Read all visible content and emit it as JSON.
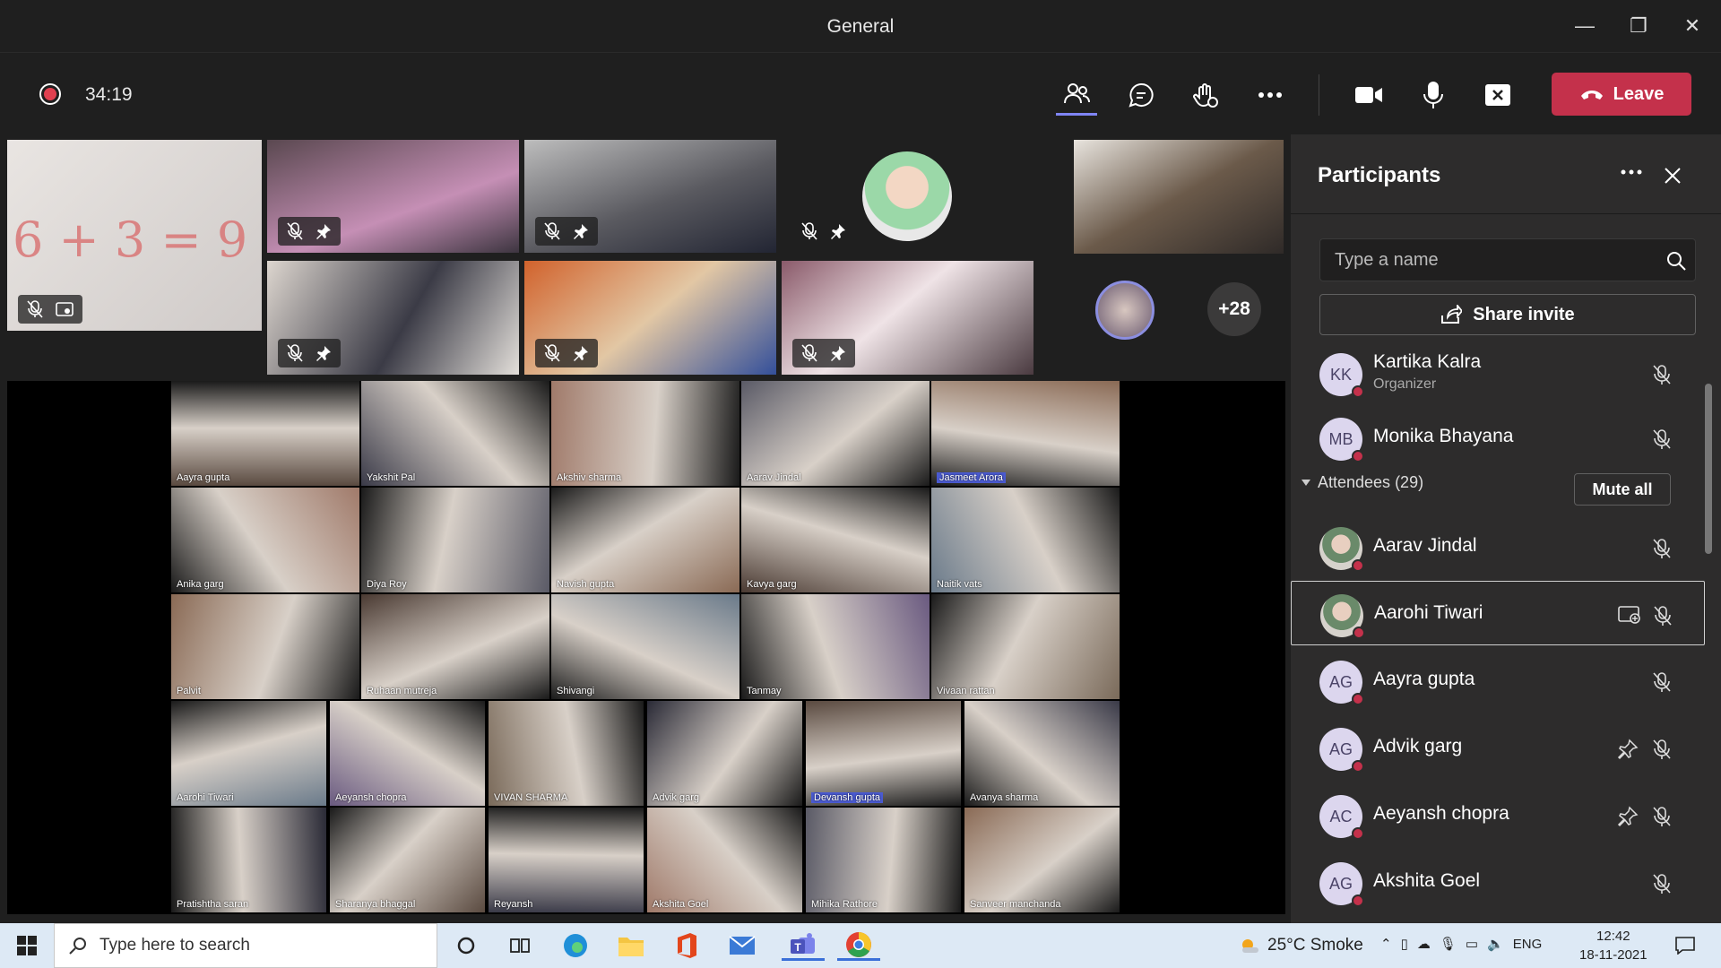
{
  "window": {
    "title": "General",
    "minimize": "—",
    "restore": "❐",
    "close": "✕"
  },
  "toolbar": {
    "timer": "34:19",
    "leave_label": "Leave",
    "colors": {
      "leave": "#c4314b",
      "recording": "#e04050"
    }
  },
  "stage": {
    "overflow_count": "+28",
    "grid_names": [
      "Aayra gupta",
      "Yakshit Pal",
      "Akshiv sharma",
      "Aarav Jindal",
      "Jasmeet Arora",
      "Anika garg",
      "Diya Roy",
      "Navish gupta",
      "Kavya garg",
      "Naitik vats",
      "Palvit",
      "Ruhaan mutreja",
      "Shivangi",
      "Tanmay",
      "Vivaan rattan",
      "Aarohi Tiwari",
      "Aeyansh chopra",
      "VIVAN SHARMA",
      "Advik garg",
      "Devansh gupta",
      "Avanya sharma",
      "Pratishtha saran",
      "Sharanya bhaggal",
      "Reyansh",
      "Akshita Goel",
      "Mihika Rathore",
      "Sanveer manchanda"
    ]
  },
  "participants": {
    "title": "Participants",
    "search_placeholder": "Type a name",
    "share_invite": "Share invite",
    "organizers": [
      {
        "initials": "KK",
        "name": "Kartika Kalra",
        "role": "Organizer"
      },
      {
        "initials": "MB",
        "name": "Monika Bhayana",
        "role": ""
      }
    ],
    "attendees_label": "Attendees (29)",
    "mute_all": "Mute all",
    "attendees": [
      {
        "initials": "",
        "name": "Aarav Jindal"
      },
      {
        "initials": "",
        "name": "Aarohi Tiwari"
      },
      {
        "initials": "AG",
        "name": "Aayra gupta"
      },
      {
        "initials": "AG",
        "name": "Advik garg"
      },
      {
        "initials": "AC",
        "name": "Aeyansh chopra"
      },
      {
        "initials": "AG",
        "name": "Akshita Goel"
      }
    ]
  },
  "taskbar": {
    "search_placeholder": "Type here to search",
    "weather": "25°C  Smoke",
    "language": "ENG",
    "time": "12:42",
    "date": "18-11-2021"
  }
}
